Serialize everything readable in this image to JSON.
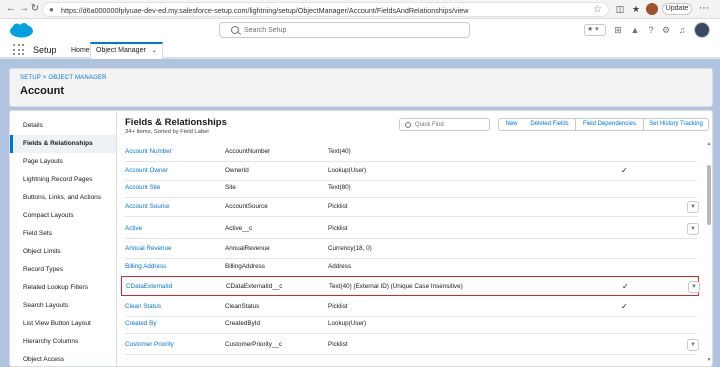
{
  "browser": {
    "url": "https://d6a000000fplyuae-dev-ed.my.salesforce-setup.com/lightning/setup/ObjectManager/Account/FieldsAndRelationships/view",
    "update_label": "Update"
  },
  "header": {
    "search_placeholder": "Search Setup"
  },
  "app_bar": {
    "app_name": "Setup",
    "tabs": [
      {
        "label": "Home"
      },
      {
        "label": "Object Manager"
      }
    ]
  },
  "page_header": {
    "breadcrumb": "SETUP > OBJECT MANAGER",
    "title": "Account"
  },
  "sidebar": {
    "items": [
      {
        "label": "Details"
      },
      {
        "label": "Fields & Relationships"
      },
      {
        "label": "Page Layouts"
      },
      {
        "label": "Lightning Record Pages"
      },
      {
        "label": "Buttons, Links, and Actions"
      },
      {
        "label": "Compact Layouts"
      },
      {
        "label": "Field Sets"
      },
      {
        "label": "Object Limits"
      },
      {
        "label": "Record Types"
      },
      {
        "label": "Related Lookup Filters"
      },
      {
        "label": "Search Layouts"
      },
      {
        "label": "List View Button Layout"
      },
      {
        "label": "Hierarchy Columns"
      },
      {
        "label": "Object Access"
      }
    ],
    "active_index": 1
  },
  "main": {
    "title": "Fields & Relationships",
    "subtitle": "34+ Items, Sorted by Field Label",
    "quick_find_placeholder": "Quick Find",
    "buttons": {
      "new": "New",
      "deleted_fields": "Deleted Fields",
      "field_dependencies": "Field Dependencies",
      "set_history_tracking": "Set History Tracking"
    },
    "rows": [
      {
        "label": "Account Number",
        "api": "AccountNumber",
        "type": "Text(40)",
        "indexed": false,
        "menu": false
      },
      {
        "label": "Account Owner",
        "api": "OwnerId",
        "type": "Lookup(User)",
        "indexed": true,
        "menu": false
      },
      {
        "label": "Account Site",
        "api": "Site",
        "type": "Text(80)",
        "indexed": false,
        "menu": false
      },
      {
        "label": "Account Source",
        "api": "AccountSource",
        "type": "Picklist",
        "indexed": false,
        "menu": true
      },
      {
        "label": "Active",
        "api": "Active__c",
        "type": "Picklist",
        "indexed": false,
        "menu": true
      },
      {
        "label": "Annual Revenue",
        "api": "AnnualRevenue",
        "type": "Currency(18, 0)",
        "indexed": false,
        "menu": false
      },
      {
        "label": "Billing Address",
        "api": "BillingAddress",
        "type": "Address",
        "indexed": false,
        "menu": false
      },
      {
        "label": "CDataExternalId",
        "api": "CDataExternalId__c",
        "type": "Text(40) (External ID) (Unique Case Insensitive)",
        "indexed": true,
        "menu": true,
        "highlighted": true
      },
      {
        "label": "Clean Status",
        "api": "CleanStatus",
        "type": "Picklist",
        "indexed": true,
        "menu": false
      },
      {
        "label": "Created By",
        "api": "CreatedById",
        "type": "Lookup(User)",
        "indexed": false,
        "menu": false
      },
      {
        "label": "Customer Priority",
        "api": "CustomerPriority__c",
        "type": "Picklist",
        "indexed": false,
        "menu": true
      }
    ]
  },
  "icons": {
    "check": "✓",
    "dropdown": "▼"
  },
  "colors": {
    "brand_blue": "#0176d3",
    "highlight_red": "#d9242b",
    "page_bg": "#b0c4df"
  }
}
